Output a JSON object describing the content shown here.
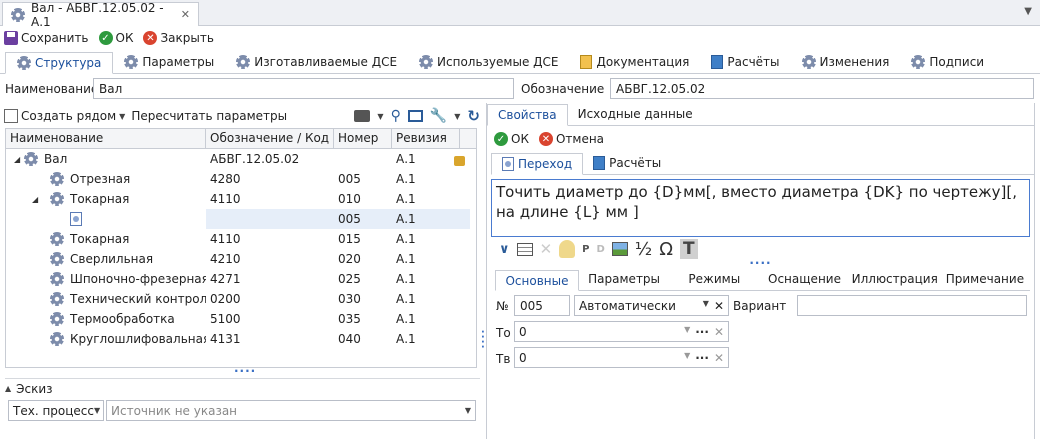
{
  "window": {
    "tab_title": "Вал - АБВГ.12.05.02 - А.1"
  },
  "toolbar": {
    "save": "Сохранить",
    "ok": "ОК",
    "close": "Закрыть"
  },
  "main_tabs": [
    "Структура",
    "Параметры",
    "Изготавливаемые ДСЕ",
    "Используемые ДСЕ",
    "Документация",
    "Расчёты",
    "Изменения",
    "Подписи"
  ],
  "header": {
    "name_label": "Наименование",
    "name_value": "Вал",
    "designation_label": "Обозначение",
    "designation_value": "АБВГ.12.05.02"
  },
  "left_toolbar": {
    "create_near": "Создать рядом",
    "recalc": "Пересчитать параметры"
  },
  "grid": {
    "columns": [
      "Наименование",
      "Обозначение / Код",
      "Номер",
      "Ревизия"
    ],
    "rows": [
      {
        "name": "Вал",
        "code": "АБВГ.12.05.02",
        "num": "",
        "rev": "А.1"
      },
      {
        "name": "Отрезная",
        "code": "4280",
        "num": "005",
        "rev": "А.1"
      },
      {
        "name": "Токарная",
        "code": "4110",
        "num": "010",
        "rev": "А.1"
      },
      {
        "name": "",
        "code": "",
        "num": "005",
        "rev": "А.1"
      },
      {
        "name": "Токарная",
        "code": "4110",
        "num": "015",
        "rev": "А.1"
      },
      {
        "name": "Сверлильная",
        "code": "4210",
        "num": "020",
        "rev": "А.1"
      },
      {
        "name": "Шпоночно-фрезерная",
        "code": "4271",
        "num": "025",
        "rev": "А.1"
      },
      {
        "name": "Технический контроль",
        "code": "0200",
        "num": "030",
        "rev": "А.1"
      },
      {
        "name": "Термообработка",
        "code": "5100",
        "num": "035",
        "rev": "А.1"
      },
      {
        "name": "Круглошлифовальная",
        "code": "4131",
        "num": "040",
        "rev": "А.1"
      }
    ]
  },
  "sketch": {
    "title": "Эскиз",
    "process": "Тех. процесс",
    "source_placeholder": "Источник не указан"
  },
  "right": {
    "tabs": [
      "Свойства",
      "Исходные данные"
    ],
    "ok": "ОК",
    "cancel": "Отмена",
    "inner_tabs": [
      "Переход",
      "Расчёты"
    ],
    "text": "Точить диаметр до {D}мм[, вместо диаметра {DK} по чертежу][, на длине {L} мм ]",
    "glyphs": {
      "p": "P",
      "d": "D",
      "half": "½",
      "omega": "Ω",
      "t": "T"
    },
    "param_tabs": [
      "Основные",
      "Параметры",
      "Режимы",
      "Оснащение",
      "Иллюстрация",
      "Примечание"
    ],
    "form": {
      "num_label": "№",
      "num_value": "005",
      "mode_value": "Автоматически",
      "variant_label": "Вариант",
      "variant_value": "",
      "to_label": "То",
      "to_value": "0",
      "tv_label": "Тв",
      "tv_value": "0"
    }
  }
}
